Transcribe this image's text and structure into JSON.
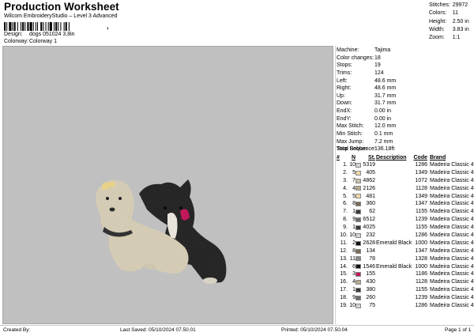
{
  "header": {
    "title": "Production Worksheet",
    "subtitle": "Wilcom EmbroideryStudio – Level 3 Advanced",
    "barcode_sep": ",",
    "design_label": "Design:",
    "design_value": "dogs 051024 3,8in",
    "colorway_label": "Colorway:",
    "colorway_value": "Colorway 1"
  },
  "stats": [
    {
      "label": "Stitches:",
      "value": "29972"
    },
    {
      "label": "Colors:",
      "value": "11"
    },
    {
      "label": "Height:",
      "value": "2.50 in"
    },
    {
      "label": "Width:",
      "value": "3.83 in"
    },
    {
      "label": "Zoom:",
      "value": "1:1"
    }
  ],
  "machine_info": [
    {
      "label": "Machine:",
      "value": "Tajima"
    },
    {
      "label": "Color changes:",
      "value": "18"
    },
    {
      "label": "Stops:",
      "value": "19"
    },
    {
      "label": "Trims:",
      "value": "124"
    },
    {
      "label": "Left:",
      "value": "48.6 mm"
    },
    {
      "label": "Right:",
      "value": "48.6 mm"
    },
    {
      "label": "Up:",
      "value": "31.7 mm"
    },
    {
      "label": "Down:",
      "value": "31.7 mm"
    },
    {
      "label": "EndX:",
      "value": "0.00 in"
    },
    {
      "label": "EndY:",
      "value": "0.00 in"
    },
    {
      "label": "Max Stitch:",
      "value": "12.0 mm"
    },
    {
      "label": "Min Stitch:",
      "value": "0.1 mm"
    },
    {
      "label": "Max Jump:",
      "value": "7.2 mm"
    },
    {
      "label": "Total Bobbin:",
      "value": "136.18ft"
    }
  ],
  "stop_sequence": {
    "title": "Stop Sequence:",
    "headers": {
      "num": "#",
      "color": "N",
      "stitches": "St.",
      "description": "Description",
      "code": "Code",
      "brand": "Brand"
    },
    "rows": [
      {
        "num": "1.",
        "color": "10",
        "swatch": "#d4d4d4",
        "stitches": "5319",
        "description": "",
        "code": "1286",
        "brand": "Madeira Classic 40"
      },
      {
        "num": "2.",
        "color": "5",
        "swatch": "#f1d7a0",
        "stitches": "405",
        "description": "",
        "code": "1349",
        "brand": "Madeira Classic 40"
      },
      {
        "num": "3.",
        "color": "7",
        "swatch": "#c5bfaa",
        "stitches": "4862",
        "description": "",
        "code": "1072",
        "brand": "Madeira Classic 40"
      },
      {
        "num": "4.",
        "color": "4",
        "swatch": "#b8a98a",
        "stitches": "2126",
        "description": "",
        "code": "1128",
        "brand": "Madeira Classic 40"
      },
      {
        "num": "5.",
        "color": "5",
        "swatch": "#f1d7a0",
        "stitches": "481",
        "description": "",
        "code": "1349",
        "brand": "Madeira Classic 40"
      },
      {
        "num": "6.",
        "color": "8",
        "swatch": "#7b6a58",
        "stitches": "360",
        "description": "",
        "code": "1347",
        "brand": "Madeira Classic 40"
      },
      {
        "num": "7.",
        "color": "1",
        "swatch": "#3a3a3a",
        "stitches": "62",
        "description": "",
        "code": "1155",
        "brand": "Madeira Classic 40"
      },
      {
        "num": "8.",
        "color": "9",
        "swatch": "#6c6c6c",
        "stitches": "6512",
        "description": "",
        "code": "1239",
        "brand": "Madeira Classic 40"
      },
      {
        "num": "9.",
        "color": "1",
        "swatch": "#3a3a3a",
        "stitches": "4025",
        "description": "",
        "code": "1155",
        "brand": "Madeira Classic 40"
      },
      {
        "num": "10.",
        "color": "10",
        "swatch": "#d4d4d4",
        "stitches": "232",
        "description": "",
        "code": "1286",
        "brand": "Madeira Classic 40"
      },
      {
        "num": "11.",
        "color": "2",
        "swatch": "#111111",
        "stitches": "2628",
        "description": "Emerald Black",
        "code": "1000",
        "brand": "Madeira Classic 40"
      },
      {
        "num": "12.",
        "color": "8",
        "swatch": "#7b6a58",
        "stitches": "134",
        "description": "",
        "code": "1347",
        "brand": "Madeira Classic 40"
      },
      {
        "num": "13.",
        "color": "11",
        "swatch": "#8b8b8b",
        "stitches": "78",
        "description": "",
        "code": "1328",
        "brand": "Madeira Classic 40"
      },
      {
        "num": "14.",
        "color": "6",
        "swatch": "#111111",
        "stitches": "1546",
        "description": "Emerald Black",
        "code": "1000",
        "brand": "Madeira Classic 40"
      },
      {
        "num": "15.",
        "color": "3",
        "swatch": "#c2185b",
        "stitches": "155",
        "description": "",
        "code": "1186",
        "brand": "Madeira Classic 40"
      },
      {
        "num": "16.",
        "color": "4",
        "swatch": "#b8a98a",
        "stitches": "430",
        "description": "",
        "code": "1128",
        "brand": "Madeira Classic 40"
      },
      {
        "num": "17.",
        "color": "1",
        "swatch": "#3a3a3a",
        "stitches": "380",
        "description": "",
        "code": "1155",
        "brand": "Madeira Classic 40"
      },
      {
        "num": "18.",
        "color": "9",
        "swatch": "#6c6c6c",
        "stitches": "260",
        "description": "",
        "code": "1239",
        "brand": "Madeira Classic 40"
      },
      {
        "num": "19.",
        "color": "10",
        "swatch": "#d4d4d4",
        "stitches": "75",
        "description": "",
        "code": "1286",
        "brand": "Madeira Classic 40"
      }
    ]
  },
  "footer": {
    "created_by": "Created By:",
    "last_saved": "Last Saved: 05/10/2024 07.50.01",
    "printed": "Printed: 05/10/2024 07.50.04",
    "page": "Page 1 of 1"
  },
  "colors": {
    "canvas_bg": "#c0c0c0",
    "dog_light": "#ddd5c0",
    "dog_dark": "#1e1e1e",
    "accent_pink": "#c2185b"
  }
}
